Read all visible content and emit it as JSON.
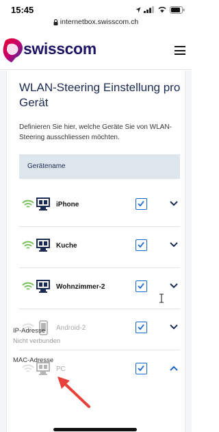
{
  "status_bar": {
    "time": "15:45"
  },
  "browser": {
    "url": "internetbox.swisscom.ch"
  },
  "header": {
    "brand": "swisscom",
    "menu_icon": "hamburger-icon"
  },
  "page": {
    "title": "WLAN-Steering Einstellung pro Gerät",
    "description": "Definieren Sie hier, welche Geräte Sie von WLAN-Steering ausschliessen möchten.",
    "column_header": "Gerätename"
  },
  "devices": [
    {
      "name": "iPhone",
      "type": "desktop",
      "connected": true,
      "checked": true,
      "expanded": false
    },
    {
      "name": "Kuche",
      "type": "desktop",
      "connected": true,
      "checked": true,
      "expanded": false
    },
    {
      "name": "Wohnzimmer-2",
      "type": "desktop",
      "connected": true,
      "checked": true,
      "expanded": false
    },
    {
      "name": "Android-2",
      "type": "phone",
      "connected": false,
      "checked": true,
      "expanded": false
    },
    {
      "name": "PC",
      "type": "desktop",
      "connected": false,
      "checked": true,
      "expanded": true
    }
  ],
  "details": {
    "ip_label": "IP-Adresse",
    "ip_value": "Nicht verbunden",
    "mac_label": "MAC-Adresse"
  },
  "colors": {
    "brand": "#1b1464",
    "accent": "#1b66c9",
    "wifi_on": "#6cc04a",
    "header_bg": "#dde6ec"
  }
}
